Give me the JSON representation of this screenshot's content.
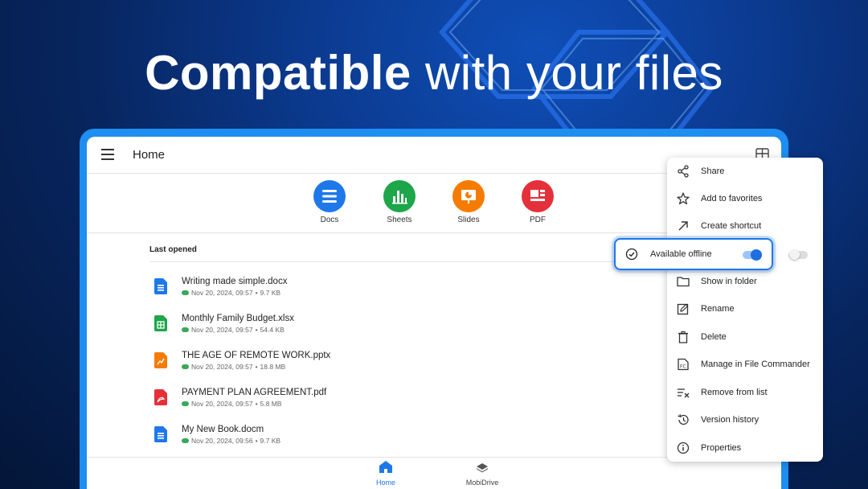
{
  "headline": {
    "bold": "Compatible",
    "rest": "with your files"
  },
  "appbar": {
    "title": "Home",
    "menu_icon": "hamburger-menu-icon",
    "view_icon": "grid-view-icon"
  },
  "apps": [
    {
      "label": "Docs",
      "color": "#1e78ea",
      "icon": "docs-icon"
    },
    {
      "label": "Sheets",
      "color": "#1ea64a",
      "icon": "sheets-icon"
    },
    {
      "label": "Slides",
      "color": "#f57c00",
      "icon": "slides-icon"
    },
    {
      "label": "PDF",
      "color": "#e5303a",
      "icon": "pdf-icon"
    }
  ],
  "last_opened": {
    "title": "Last opened",
    "files": [
      {
        "name": "Writing made simple.docx",
        "date": "Nov 20, 2024, 09:57",
        "size": "9.7 KB",
        "type": "doc",
        "color": "#1e78ea"
      },
      {
        "name": "Monthly Family Budget.xlsx",
        "date": "Nov 20, 2024, 09:57",
        "size": "54.4 KB",
        "type": "sheet",
        "color": "#1ea64a"
      },
      {
        "name": "THE AGE OF REMOTE WORK.pptx",
        "date": "Nov 20, 2024, 09:57",
        "size": "18.8 MB",
        "type": "slide",
        "color": "#f57c00"
      },
      {
        "name": "PAYMENT PLAN AGREEMENT.pdf",
        "date": "Nov 20, 2024, 09:57",
        "size": "5.8 MB",
        "type": "pdf",
        "color": "#e5303a"
      },
      {
        "name": "My New Book.docm",
        "date": "Nov 20, 2024, 09:56",
        "size": "9.7 KB",
        "type": "doc",
        "color": "#1e78ea"
      }
    ]
  },
  "bottom_nav": [
    {
      "label": "Home",
      "icon": "home-icon",
      "active": true
    },
    {
      "label": "MobiDrive",
      "icon": "mobidrive-icon",
      "active": false
    }
  ],
  "context_menu": [
    {
      "label": "Share",
      "icon": "share-icon"
    },
    {
      "label": "Add to favorites",
      "icon": "star-icon"
    },
    {
      "label": "Create shortcut",
      "icon": "shortcut-arrow-icon"
    },
    {
      "label": "",
      "icon": "",
      "toggle": true
    },
    {
      "label": "Show in folder",
      "icon": "folder-icon"
    },
    {
      "label": "Rename",
      "icon": "rename-icon"
    },
    {
      "label": "Delete",
      "icon": "trash-icon"
    },
    {
      "label": "Manage in File Commander",
      "icon": "file-commander-icon"
    },
    {
      "label": "Remove from list",
      "icon": "remove-from-list-icon"
    },
    {
      "label": "Version history",
      "icon": "history-icon"
    },
    {
      "label": "Properties",
      "icon": "info-icon"
    }
  ],
  "offline": {
    "label": "Available offline",
    "icon": "offline-check-icon",
    "enabled": true
  },
  "colors": {
    "accent": "#1e78ea",
    "frame": "#1e8ef0",
    "background": "#07255e"
  }
}
